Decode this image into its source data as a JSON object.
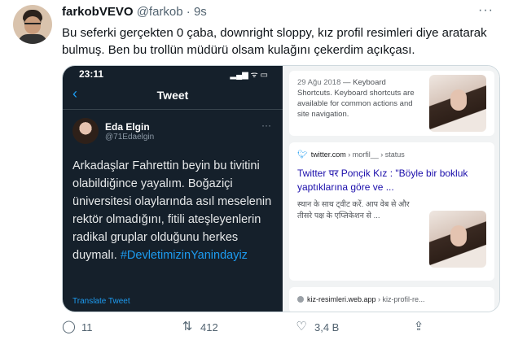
{
  "tweet": {
    "name": "farkobVEVO",
    "handle": "@farkob",
    "separator": "·",
    "time": "9s",
    "more": "···",
    "text": "Bu seferki gerçekten 0 çaba, downright sloppy, kız profil resimleri diye aratarak bulmuş. Ben bu trollün müdürü olsam kulağını çekerdim açıkçası."
  },
  "phone": {
    "clock": "23:11",
    "status_icons": "▂▄▆ ᯤ ▭",
    "back_icon": "‹",
    "title": "Tweet",
    "author_name": "Eda Elgin",
    "author_handle": "@71Edaelgin",
    "more": "···",
    "body": "Arkadaşlar Fahrettin beyin bu tivitini olabildiğince yayalım. Boğaziçi üniversitesi olaylarında asıl meselenin rektör olmadığını, fitili ateşleyenlerin radikal gruplar olduğunu herkes duymalı.",
    "hashtag": "#DevletimizinYanindayiz",
    "translate": "Translate Tweet"
  },
  "results": {
    "card1": {
      "date": "29 Ağu 2018",
      "snippet": " — Keyboard Shortcuts. Keyboard shortcuts are available for common actions and site navigation."
    },
    "card2": {
      "source": "twitter.com",
      "path": " › morfil__ › status",
      "title": "Twitter पर Ponçik Kız : \"Böyle bir bokluk yaptıklarına göre ve ...",
      "desc": "स्थान के साथ ट्वीट करें. आप वेब से और तीसरे पक्ष के एप्लिकेशन से ..."
    },
    "card3": {
      "source": "kiz-resimleri.web.app",
      "path": " › kiz-profil-re..."
    }
  },
  "actions": {
    "reply_count": "11",
    "retweet_count": "412",
    "like_count": "3,4 B",
    "reply_icon": "◯",
    "retweet_icon": "⇅",
    "like_icon": "♡",
    "share_icon": "⇪"
  }
}
